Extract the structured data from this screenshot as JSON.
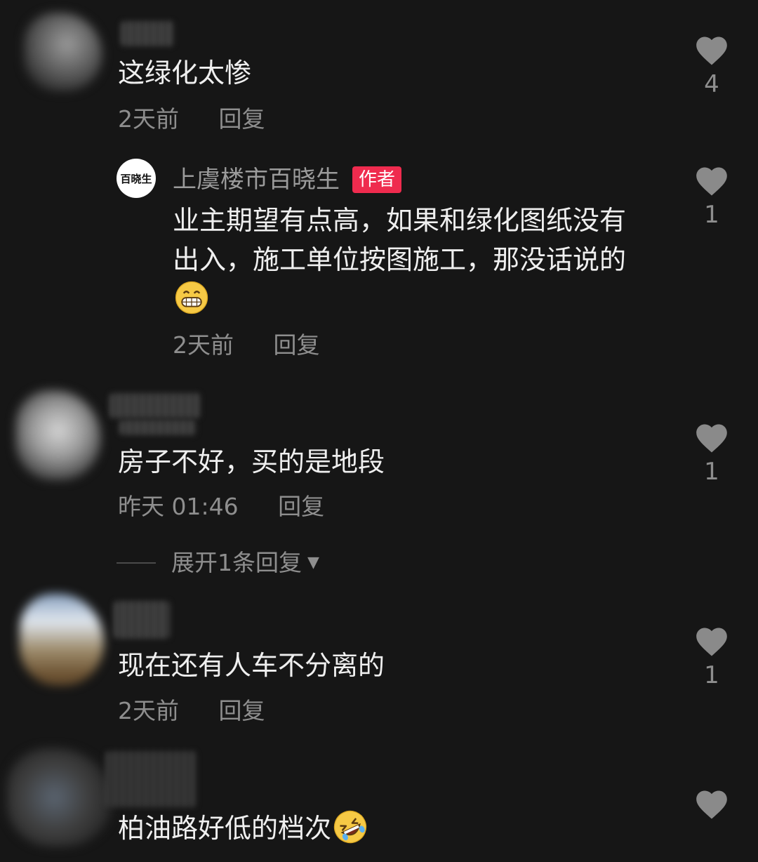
{
  "comments": [
    {
      "text": "这绿化太惨",
      "time": "2天前",
      "reply_label": "回复",
      "likes": "4",
      "reply": {
        "author": "上虞楼市百晓生",
        "author_avatar_text": "百晓生",
        "badge": "作者",
        "text": "业主期望有点高，如果和绿化图纸没有出入，施工单位按图施工，那没话说的",
        "emoji": "grinning-face-emoji",
        "time": "2天前",
        "reply_label": "回复",
        "likes": "1"
      }
    },
    {
      "text": "房子不好，买的是地段",
      "time": "昨天 01:46",
      "reply_label": "回复",
      "likes": "1",
      "expand_label": "展开1条回复"
    },
    {
      "text": "现在还有人车不分离的",
      "time": "2天前",
      "reply_label": "回复",
      "likes": "1"
    },
    {
      "text": "柏油路好低的档次",
      "emoji": "rolling-on-the-floor-laughing-emoji"
    }
  ],
  "colors": {
    "background": "#161616",
    "text": "#efefef",
    "meta": "#8e8e8e",
    "heart": "#8a8a8a",
    "author_badge": "#ef2b4e"
  }
}
